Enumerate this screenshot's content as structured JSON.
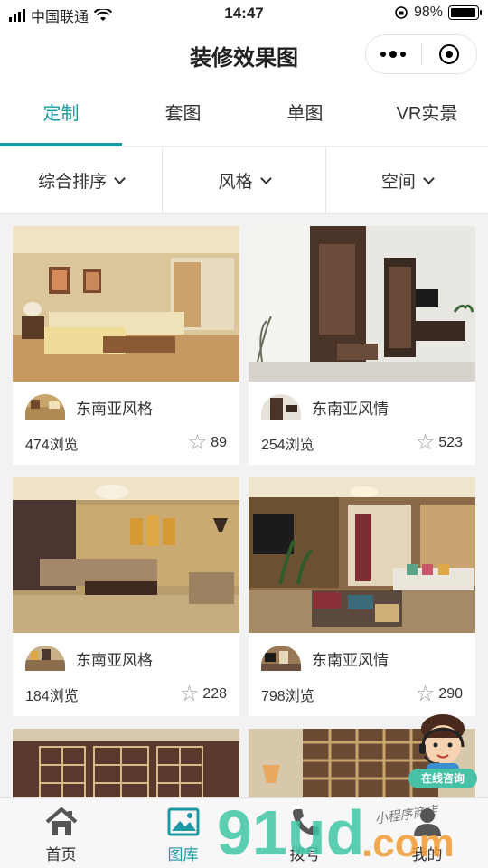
{
  "status": {
    "carrier": "中国联通",
    "time": "14:47",
    "battery": "98%",
    "battery_level": 0.98
  },
  "nav": {
    "title": "装修效果图"
  },
  "tabs": [
    {
      "label": "定制",
      "active": true
    },
    {
      "label": "套图",
      "active": false
    },
    {
      "label": "单图",
      "active": false
    },
    {
      "label": "VR实景",
      "active": false
    }
  ],
  "filters": [
    {
      "label": "综合排序"
    },
    {
      "label": "风格"
    },
    {
      "label": "空间"
    }
  ],
  "cards": [
    {
      "style": "东南亚风格",
      "views": "474浏览",
      "likes": "89"
    },
    {
      "style": "东南亚风情",
      "views": "254浏览",
      "likes": "523"
    },
    {
      "style": "东南亚风格",
      "views": "184浏览",
      "likes": "228"
    },
    {
      "style": "东南亚风情",
      "views": "798浏览",
      "likes": "290"
    }
  ],
  "consult": {
    "label": "在线咨询"
  },
  "tabbar": [
    {
      "label": "首页",
      "icon": "home-icon",
      "active": false
    },
    {
      "label": "图库",
      "icon": "image-icon",
      "active": true
    },
    {
      "label": "拨号",
      "icon": "phone-icon",
      "active": false
    },
    {
      "label": "我的",
      "icon": "user-icon",
      "active": false
    }
  ],
  "watermark": {
    "brand": "91ud",
    "suffix": ".com",
    "tagline": "小程序商店"
  },
  "colors": {
    "accent": "#1b9aa3",
    "consult": "#47c2a6"
  }
}
